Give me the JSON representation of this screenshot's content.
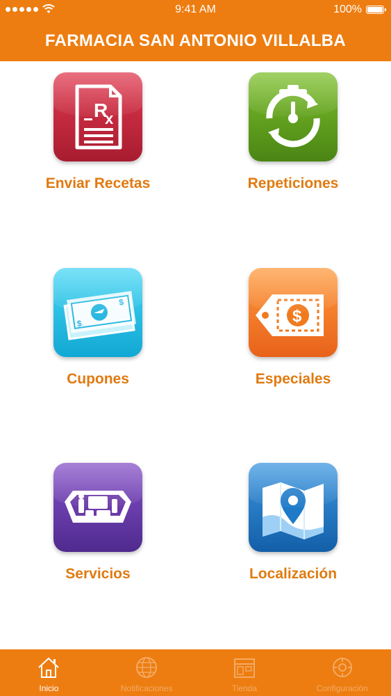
{
  "status_bar": {
    "time": "9:41 AM",
    "battery": "100%"
  },
  "header": {
    "title": "FARMACIA SAN ANTONIO VILLALBA"
  },
  "tiles": [
    {
      "label": "Enviar Recetas",
      "icon": "prescription-icon",
      "color": "#c8283d"
    },
    {
      "label": "Repeticiones",
      "icon": "stopwatch-refresh-icon",
      "color": "#5e9a1a"
    },
    {
      "label": "Cupones",
      "icon": "coupon-bill-icon",
      "color": "#2ec4e8"
    },
    {
      "label": "Especiales",
      "icon": "price-tag-icon",
      "color": "#f07a1e"
    },
    {
      "label": "Servicios",
      "icon": "toolbox-icon",
      "color": "#6b3aa8"
    },
    {
      "label": "Localización",
      "icon": "map-pin-icon",
      "color": "#1f7ac8"
    }
  ],
  "tabs": [
    {
      "label": "Inicio",
      "icon": "home-icon",
      "active": true
    },
    {
      "label": "Notificaciones",
      "icon": "globe-icon",
      "active": false
    },
    {
      "label": "Tienda",
      "icon": "store-icon",
      "active": false
    },
    {
      "label": "Configuración",
      "icon": "settings-icon",
      "active": false
    }
  ],
  "colors": {
    "accent": "#ed7d10",
    "label": "#e07a10"
  }
}
